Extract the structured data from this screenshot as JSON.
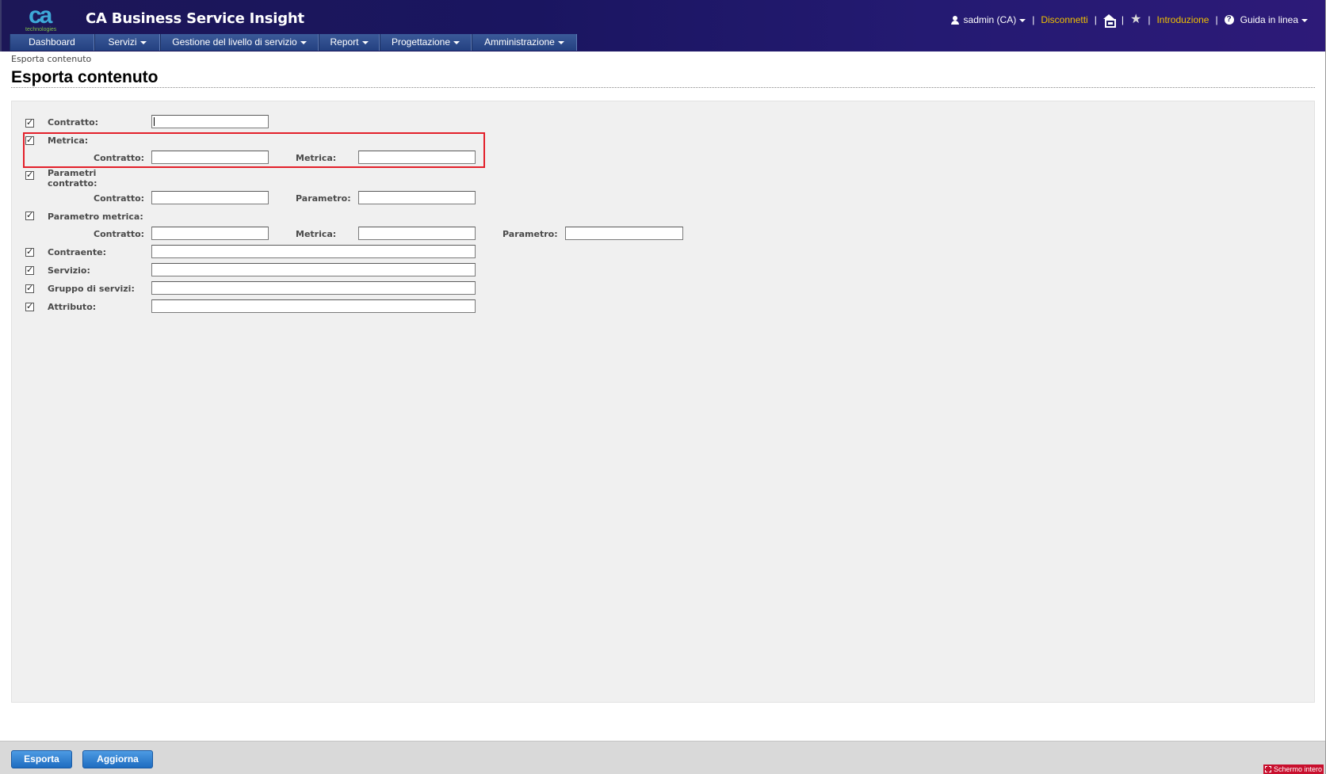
{
  "app": {
    "title": "CA Business Service Insight",
    "logo_text": "ca",
    "logo_sub": "technologies"
  },
  "toplinks": {
    "user": "sadmin (CA)",
    "logout": "Disconnetti",
    "intro": "Introduzione",
    "help": "Guida in linea"
  },
  "nav": {
    "items": [
      {
        "label": "Dashboard"
      },
      {
        "label": "Servizi"
      },
      {
        "label": "Gestione del livello di servizio"
      },
      {
        "label": "Report"
      },
      {
        "label": "Progettazione"
      },
      {
        "label": "Amministrazione"
      }
    ]
  },
  "breadcrumb": "Esporta contenuto",
  "page_title": "Esporta contenuto",
  "form": {
    "contratto": {
      "label": "Contratto:",
      "checked": true,
      "value": ""
    },
    "metrica": {
      "label": "Metrica:",
      "checked": true,
      "sub_contratto_label": "Contratto:",
      "sub_metrica_label": "Metrica:"
    },
    "parametri_contratto": {
      "label_line1": "Parametri",
      "label_line2": "contratto:",
      "checked": true,
      "sub_contratto_label": "Contratto:",
      "sub_parametro_label": "Parametro:"
    },
    "parametro_metrica": {
      "label": "Parametro metrica:",
      "checked": true,
      "sub_contratto_label": "Contratto:",
      "sub_metrica_label": "Metrica:",
      "sub_parametro_label": "Parametro:"
    },
    "contraente": {
      "label": "Contraente:",
      "checked": true
    },
    "servizio": {
      "label": "Servizio:",
      "checked": true
    },
    "gruppo_servizi": {
      "label": "Gruppo di servizi:",
      "checked": true
    },
    "attributo": {
      "label": "Attributo:",
      "checked": true
    }
  },
  "footer": {
    "export_button": "Esporta",
    "refresh_button": "Aggiorna",
    "fullscreen": "Schermo intero"
  },
  "colors": {
    "header_bg": "#1c1757",
    "link_yellow": "#f0c000",
    "button_blue": "#1e6cc0",
    "highlight_red": "#e3202a"
  }
}
